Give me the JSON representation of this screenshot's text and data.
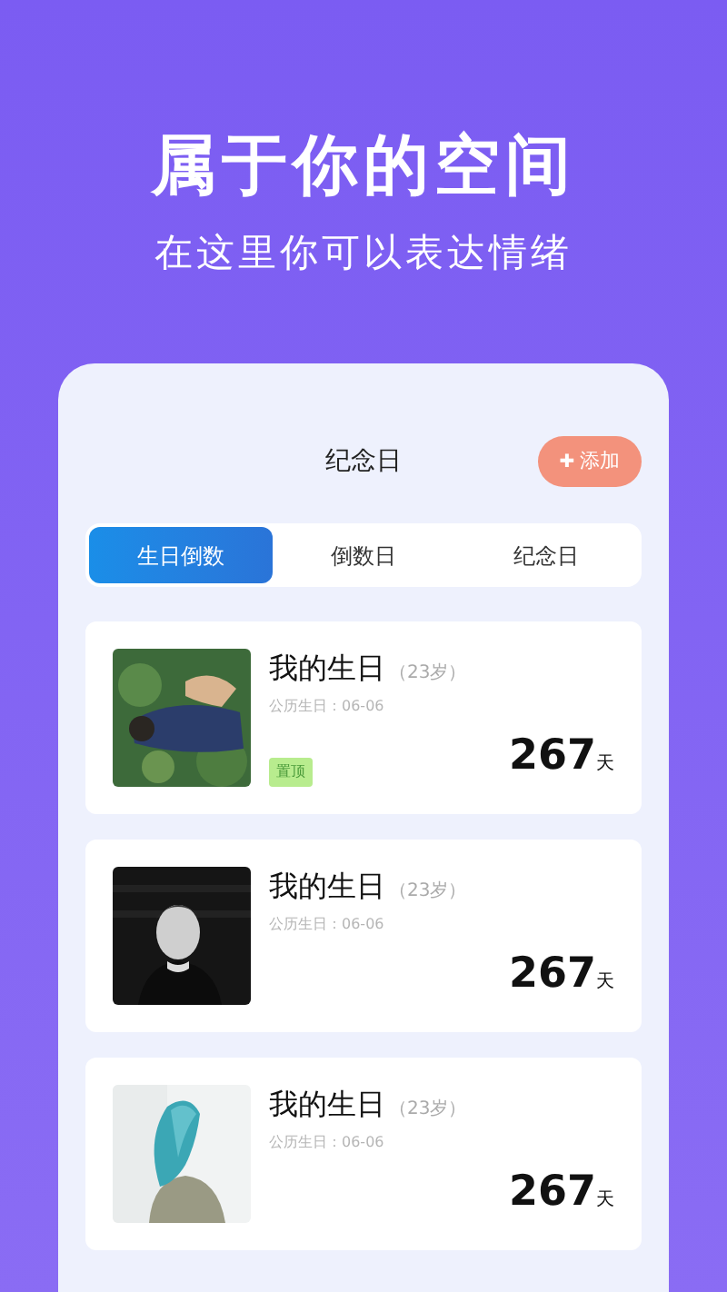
{
  "headline": "属于你的空间",
  "subtitle": "在这里你可以表达情绪",
  "screen": {
    "title": "纪念日",
    "add_button": {
      "icon": "✚",
      "label": "添加"
    },
    "tabs": [
      {
        "label": "生日倒数",
        "selected": true
      },
      {
        "label": "倒数日",
        "selected": false
      },
      {
        "label": "纪念日",
        "selected": false
      }
    ],
    "items": [
      {
        "title": "我的生日",
        "age": "（23岁）",
        "date": "公历生日：06-06",
        "tag": "置顶",
        "count": "267",
        "unit": "天",
        "kind": "picture"
      },
      {
        "title": "我的生日",
        "age": "（23岁）",
        "date": "公历生日：06-06",
        "count": "267",
        "unit": "天",
        "kind": "picture"
      },
      {
        "title": "我的生日",
        "age": "（23岁）",
        "date": "公历生日：06-06",
        "count": "267",
        "unit": "天",
        "kind": "picture"
      }
    ]
  }
}
